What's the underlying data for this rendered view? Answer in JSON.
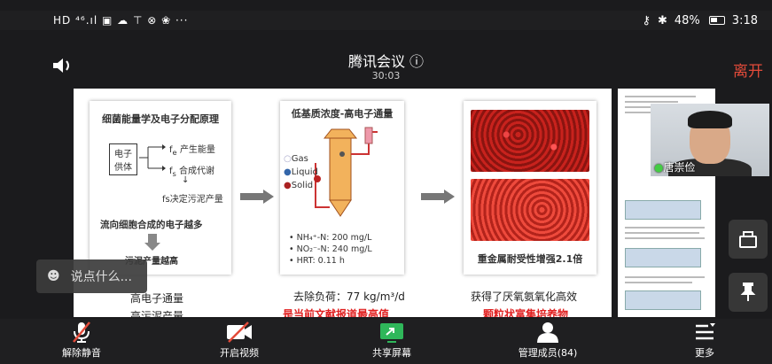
{
  "status_bar": {
    "time": "3:18",
    "battery": "48%",
    "left_icons": "HD ⁴⁶.ıl ▣ ☁ ⊤ ⊗ ❀ ···"
  },
  "header": {
    "title": "腾讯会议",
    "info_icon": "ⓘ",
    "timer": "30:03",
    "leave_label": "离开"
  },
  "slide": {
    "panel1": {
      "title": "细菌能量学及电子分配原理",
      "donor": "电子供体",
      "fe_label": "f",
      "fe_sub": "e",
      "fe_text": " 产生能量",
      "fs_label": "f",
      "fs_sub": "s",
      "fs_text": " 合成代谢",
      "fs_note": "fs决定污泥产量",
      "flow": "流向细胞合成的电子越多",
      "result": "污泥产量越高"
    },
    "panel2": {
      "title": "低基质浓度-高电子通量",
      "legend": [
        "Gas",
        "Liquid",
        "Solid"
      ],
      "nh4": "NH₄⁺-N:  200 mg/L",
      "no2": "NO₂⁻-N:  240 mg/L",
      "hrt": "HRT:  0.11 h"
    },
    "panel3": {
      "caption": "重金属耐受性增强2.1倍"
    },
    "below": {
      "c1": "高电子通量",
      "c1b": "高污泥产量",
      "c2": "去除负荷：77 kg/m³/d",
      "c2b": "是当前文献报道最高值",
      "c3": "获得了厌氧氨氧化高效",
      "c3b": "颗粒状富集培养物"
    }
  },
  "participant": {
    "name": "唐崇俭"
  },
  "chat": {
    "placeholder": "说点什么..."
  },
  "toolbar": {
    "mute": "解除静音",
    "video": "开启视频",
    "share": "共享屏幕",
    "members": "管理成员(84)",
    "more": "更多"
  }
}
